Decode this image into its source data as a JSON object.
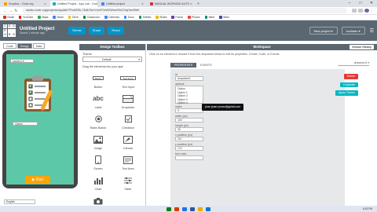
{
  "browser": {
    "tabs": [
      {
        "title": "Dropbox - Code.org",
        "active": false,
        "color": "#ff9800"
      },
      {
        "title": "Untitled Project - App Lab - Code.org",
        "active": true,
        "color": "#00adbc"
      },
      {
        "title": "Untitled project",
        "active": false,
        "color": "#4285f4"
      },
      {
        "title": "MANUAL WORKING AUTO",
        "active": false,
        "color": "#d32f2f"
      }
    ],
    "new_tab": "+",
    "window_controls": [
      "–",
      "□",
      "✕"
    ],
    "url": "studio.code.org/projects/applab/7FmbE0b-7A4k7kmYwrrF0vWZWmsSMJ7dqYeuf5Wt",
    "bookmarks": [
      {
        "label": "Gmail",
        "color": "#d93025"
      },
      {
        "label": "YouTube",
        "color": "#ff0000"
      },
      {
        "label": "Maps",
        "color": "#34a853"
      },
      {
        "label": "News",
        "color": "#4285f4"
      },
      {
        "label": "Drive",
        "color": "#fbbc04"
      },
      {
        "label": "Classroom",
        "color": "#188038"
      },
      {
        "label": "Calendar",
        "color": "#4285f4"
      },
      {
        "label": "Docs",
        "color": "#4285f4"
      },
      {
        "label": "Sheets",
        "color": "#0f9d58"
      },
      {
        "label": "Slides",
        "color": "#f4b400"
      },
      {
        "label": "Forms",
        "color": "#673ab7"
      },
      {
        "label": "Photos",
        "color": "#ea4335"
      },
      {
        "label": "Meet",
        "color": "#00897b"
      },
      {
        "label": "Sites",
        "color": "#3949ab"
      }
    ]
  },
  "app": {
    "logo_letters": [
      "C",
      "O",
      "D",
      "E",
      "",
      "",
      "O",
      "R",
      "G"
    ],
    "project_title": "Untitled Project",
    "project_subtitle": "Saved 1 minute ago",
    "header_buttons": [
      "Remix",
      "Share",
      "Reset"
    ],
    "new_project": "New project ▾",
    "account": "kcollado ▾",
    "menu_icon": "☰"
  },
  "preview": {
    "modes": [
      "Code",
      "Design",
      "Data"
    ],
    "active_mode": "Design",
    "screen_select": "screen1 ▾",
    "dropdown_value": "Option",
    "run_label": "▶ Run",
    "language": "English",
    "theme_bg": "#5cc8a8"
  },
  "toolbox": {
    "header": "Design Toolbox",
    "theme_label": "Theme",
    "theme_value": "Default",
    "hint": "Drag the elements into your app!",
    "widgets": [
      {
        "label": "Button",
        "icon": "button-icon"
      },
      {
        "label": "Text Input",
        "icon": "text-input-icon"
      },
      {
        "label": "Label",
        "icon": "label-icon"
      },
      {
        "label": "Dropdown",
        "icon": "dropdown-icon"
      },
      {
        "label": "Radio Button",
        "icon": "radio-icon"
      },
      {
        "label": "Checkbox",
        "icon": "checkbox-icon"
      },
      {
        "label": "Image",
        "icon": "image-icon"
      },
      {
        "label": "Canvas",
        "icon": "canvas-icon"
      },
      {
        "label": "Screen",
        "icon": "screen-icon"
      },
      {
        "label": "Text Area",
        "icon": "text-area-icon"
      },
      {
        "label": "Chart",
        "icon": "chart-icon"
      },
      {
        "label": "Slider",
        "icon": "slider-icon"
      },
      {
        "label": "Photo Select",
        "icon": "camera-icon"
      }
    ],
    "button_glyph": "Button",
    "input_glyph": "Text Input",
    "label_glyph": "abc"
  },
  "workspace": {
    "header": "Workspace",
    "version_history": "Version History",
    "hint": "Click on an element or choose it from the dropdown below to edit its properties. Create, Code, or Events.",
    "element_select": "dropdown1 ▾",
    "tabs": [
      "PROPERTIES",
      "EVENTS"
    ],
    "properties": [
      {
        "label": "id",
        "value": "dropdown1"
      },
      {
        "label": "options",
        "value": "Option\nOption 1\nOption 2\nOption 3\nOption 4"
      },
      {
        "label": "index",
        "value": "0"
      },
      {
        "label": "width (px)",
        "value": "100"
      },
      {
        "label": "height (px)",
        "value": "30"
      },
      {
        "label": "x position (px)",
        "value": "110"
      },
      {
        "label": "y position (px)",
        "value": "170"
      },
      {
        "label": "text color",
        "value": ""
      }
    ],
    "tooltip": "pnar   pnaro   pnaro@gmail.com",
    "actions": {
      "delete": "Delete",
      "duplicate": "Duplicate",
      "apply_theme": "Apply Theme"
    }
  },
  "taskbar": {
    "icons": [
      "#0078d4",
      "#f2a900",
      "#2b579a",
      "#1a73e8",
      "#d83b01",
      "#107c10"
    ],
    "clock": "8:43 PM"
  }
}
